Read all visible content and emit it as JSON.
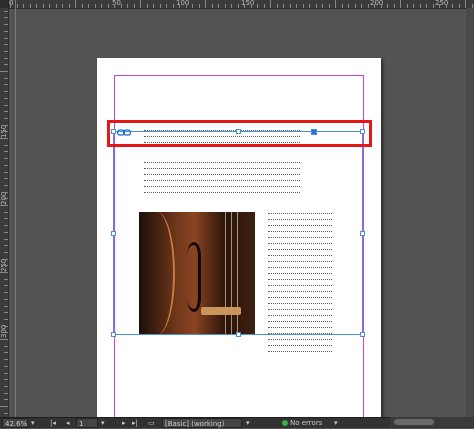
{
  "ruler": {
    "top_labels": [
      "0",
      "50",
      "100",
      "150",
      "200",
      "250"
    ],
    "left_labels": [
      "150",
      "200",
      "250",
      "300"
    ]
  },
  "status": {
    "zoom": "42.6%",
    "page_number": "1",
    "preflight_profile": "[Basic] (working)",
    "errors_text": "No errors"
  },
  "icons": {
    "thread": "link-chain-icon",
    "prev_page": "first-page-icon",
    "next_page": "next-page-icon",
    "preflight": "green-dot-icon"
  },
  "colors": {
    "selection_highlight": "#e01818",
    "frame_selection": "#4a90d9",
    "margin_guide": "#d53fd5"
  }
}
